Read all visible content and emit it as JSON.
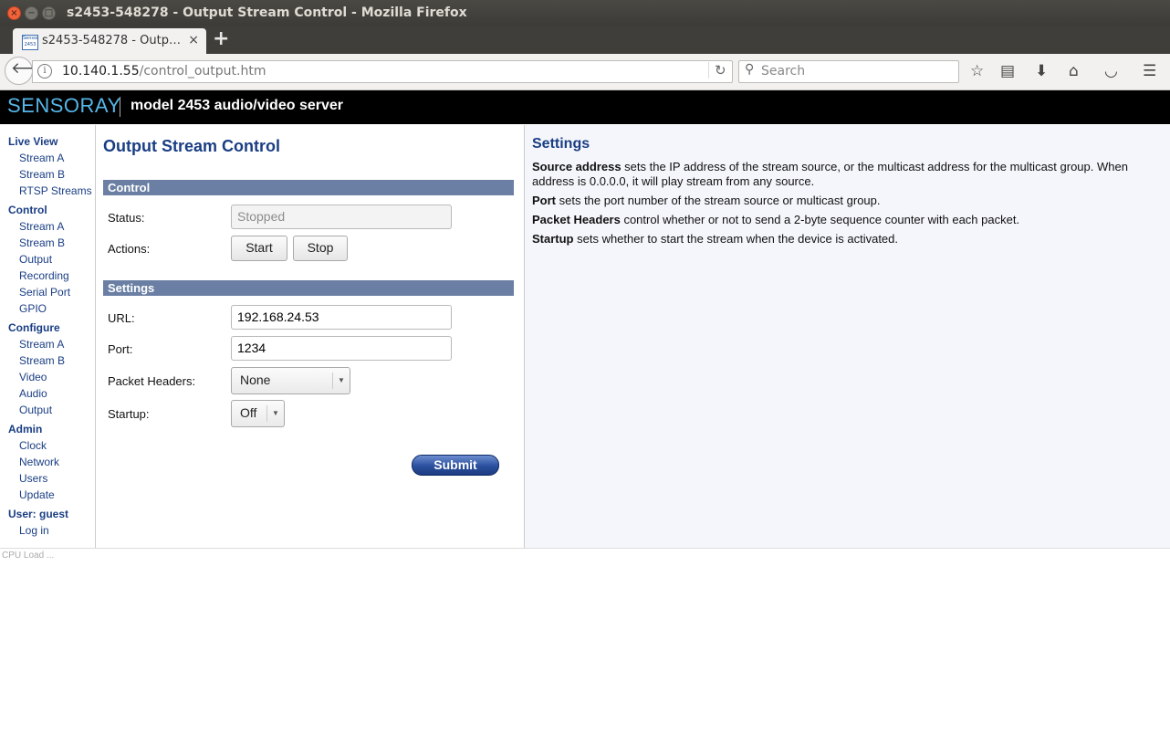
{
  "window": {
    "title": "s2453-548278 - Output Stream Control - Mozilla Firefox",
    "close_glyph": "×",
    "min_glyph": "−",
    "max_glyph": "□"
  },
  "tab": {
    "favicon_text": "Sensoray 2453",
    "title": "s2453-548278 - Outp…",
    "close_glyph": "×",
    "new_tab_glyph": "+"
  },
  "navbar": {
    "back_glyph": "🡐",
    "info_glyph": "i",
    "url_host": "10.140.1.55",
    "url_path": "/control_output.htm",
    "reload_glyph": "↻",
    "search_glyph": "⚲",
    "search_placeholder": "Search",
    "icons": [
      "bookmark-star-icon",
      "reading-list-icon",
      "download-icon",
      "home-icon",
      "pocket-icon",
      "hamburger-menu-icon"
    ],
    "icon_glyphs": [
      "☆",
      "▤",
      "⬇",
      "⌂",
      "◡",
      "☰"
    ]
  },
  "header": {
    "brand": "SENSORAY",
    "subtitle": "model 2453 audio/video server"
  },
  "leftnav": {
    "live_view": "Live View",
    "live_items": [
      "Stream A",
      "Stream B",
      "RTSP Streams"
    ],
    "control": "Control",
    "control_items": [
      "Stream A",
      "Stream B",
      "Output",
      "Recording",
      "Serial Port",
      "GPIO"
    ],
    "configure": "Configure",
    "configure_items": [
      "Stream A",
      "Stream B",
      "Video",
      "Audio",
      "Output"
    ],
    "admin": "Admin",
    "admin_items": [
      "Clock",
      "Network",
      "Users",
      "Update"
    ],
    "user": "User: guest",
    "user_items": [
      "Log in"
    ]
  },
  "form": {
    "title": "Output Stream Control",
    "control_header": "Control",
    "status_label": "Status:",
    "status_value": "Stopped",
    "actions_label": "Actions:",
    "start_label": "Start",
    "stop_label": "Stop",
    "settings_header": "Settings",
    "url_label": "URL:",
    "url_value": "192.168.24.53",
    "port_label": "Port:",
    "port_value": "1234",
    "headers_label": "Packet Headers:",
    "headers_value": "None",
    "startup_label": "Startup:",
    "startup_value": "Off",
    "select_arrow": "▼",
    "submit_label": "Submit"
  },
  "help": {
    "title": "Settings",
    "items": [
      {
        "term": "Source address",
        "text": " sets the IP address of the stream source, or the multicast address for the multicast group. When address is 0.0.0.0, it will play stream from any source."
      },
      {
        "term": "Port",
        "text": " sets the port number of the stream source or multicast group."
      },
      {
        "term": "Packet Headers",
        "text": " control whether or not to send a 2-byte sequence counter with each packet."
      },
      {
        "term": "Startup",
        "text": " sets whether to start the stream when the device is activated."
      }
    ]
  },
  "footer": {
    "cpu_load": "CPU Load ..."
  }
}
